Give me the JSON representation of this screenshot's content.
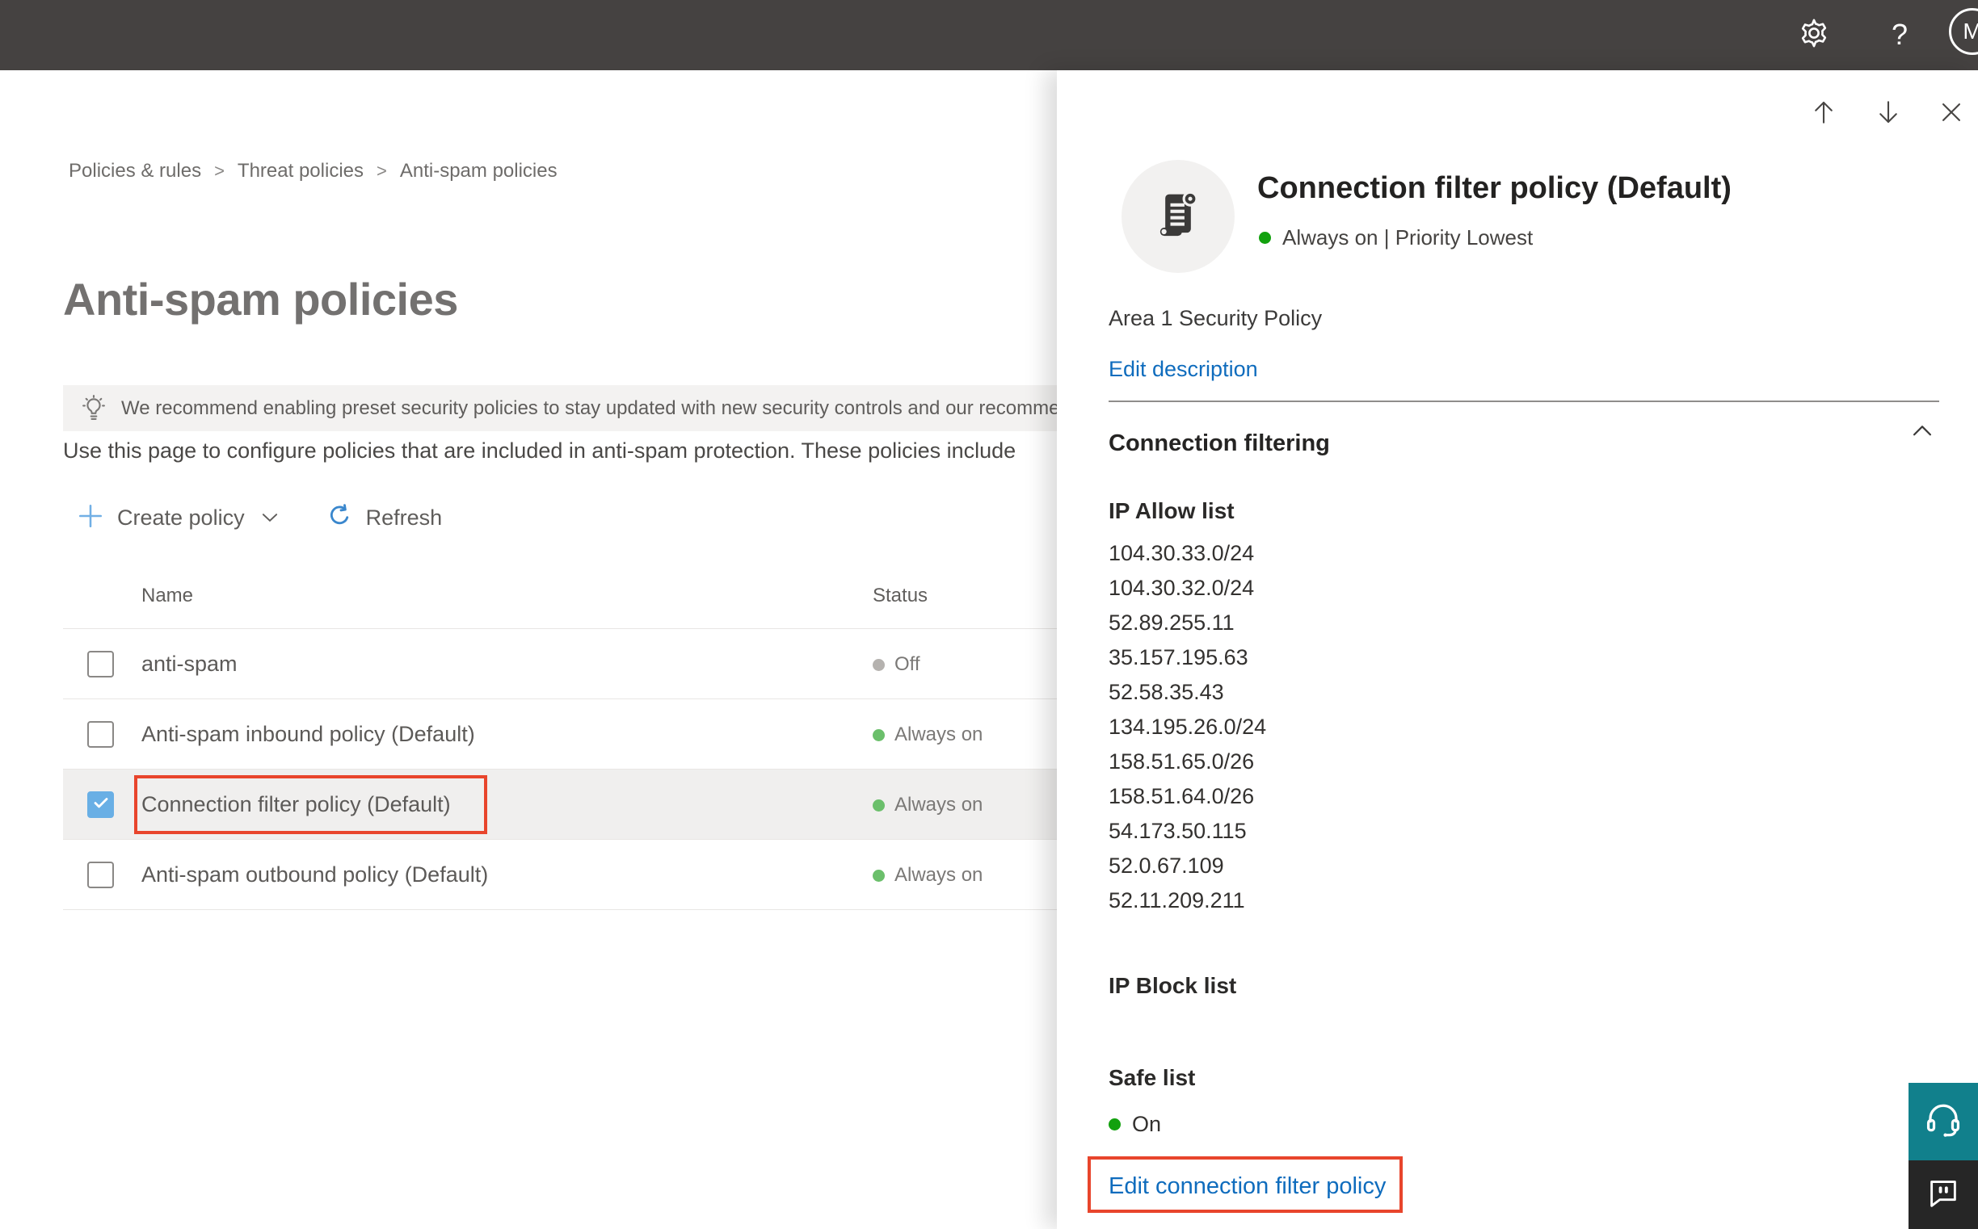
{
  "topbar": {
    "help_glyph": "?",
    "avatar_initial": "M"
  },
  "breadcrumb": {
    "items": [
      "Policies & rules",
      "Threat policies",
      "Anti-spam policies"
    ],
    "separator": ">"
  },
  "main": {
    "title": "Anti-spam policies",
    "banner_text": "We recommend enabling preset security policies to stay updated with new security controls and our recomme",
    "intro_text": "Use this page to configure policies that are included in anti-spam protection. These policies include",
    "toolbar": {
      "create_label": "Create policy",
      "refresh_label": "Refresh"
    },
    "table": {
      "headers": {
        "name": "Name",
        "status": "Status"
      },
      "rows": [
        {
          "name": "anti-spam",
          "status": "Off",
          "dot_class": "dot dot-gray"
        },
        {
          "name": "Anti-spam inbound policy (Default)",
          "status": "Always on",
          "dot_class": "dot dot-green"
        },
        {
          "name": "Connection filter policy (Default)",
          "status": "Always on",
          "dot_class": "dot dot-green"
        },
        {
          "name": "Anti-spam outbound policy (Default)",
          "status": "Always on",
          "dot_class": "dot dot-green"
        }
      ]
    }
  },
  "panel": {
    "title": "Connection filter policy (Default)",
    "status_text": "Always on | Priority Lowest",
    "description": "Area 1 Security Policy",
    "edit_description_label": "Edit description",
    "section_title": "Connection filtering",
    "ip_allow_label": "IP Allow list",
    "ip_allow_items": [
      "104.30.33.0/24",
      "104.30.32.0/24",
      "52.89.255.11",
      "35.157.195.63",
      "52.58.35.43",
      "134.195.26.0/24",
      "158.51.65.0/26",
      "158.51.64.0/26",
      "54.173.50.115",
      "52.0.67.109",
      "52.11.209.211"
    ],
    "ip_block_label": "IP Block list",
    "safe_list_label": "Safe list",
    "safe_list_status": "On",
    "edit_link_label": "Edit connection filter policy"
  },
  "colors": {
    "topbar_bg": "#454241",
    "link_blue": "#0f6cbd",
    "status_green_bright": "#12a10e",
    "status_green_soft": "#6bbf6b",
    "status_gray": "#b5b2af",
    "annotation_red": "#e8452c",
    "selected_row_bg": "#f0efee",
    "banner_bg": "#f3f2f1",
    "checkbox_blue": "#69afe5",
    "support_teal": "#11808c",
    "feedback_dark": "#262626"
  }
}
